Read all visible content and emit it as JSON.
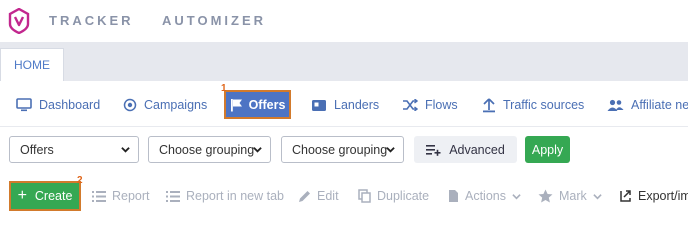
{
  "apps": {
    "tracker": "TRACKER",
    "automizer": "AUTOMIZER"
  },
  "tabs": {
    "home": "HOME"
  },
  "nav": {
    "items": [
      {
        "label": "Dashboard",
        "icon": "monitor-icon"
      },
      {
        "label": "Campaigns",
        "icon": "target-icon"
      },
      {
        "label": "Offers",
        "icon": "flag-icon",
        "active": true,
        "marker": "1"
      },
      {
        "label": "Landers",
        "icon": "lander-icon"
      },
      {
        "label": "Flows",
        "icon": "shuffle-icon"
      },
      {
        "label": "Traffic sources",
        "icon": "arrow-up-icon"
      },
      {
        "label": "Affiliate net",
        "icon": "users-icon"
      }
    ]
  },
  "filters": {
    "entity": "Offers",
    "grouping1": "Choose grouping",
    "grouping2": "Choose grouping",
    "advanced": "Advanced",
    "apply": "Apply"
  },
  "toolbar": {
    "create": "Create",
    "create_marker": "2",
    "report": "Report",
    "report_new_tab": "Report in new tab",
    "edit": "Edit",
    "duplicate": "Duplicate",
    "actions": "Actions",
    "mark": "Mark",
    "export": "Export/im"
  },
  "colors": {
    "brand_pink": "#c2278e",
    "nav_blue": "#4a6fb4",
    "active_bg": "#4d74c4",
    "highlight_orange": "#d27a2c",
    "green": "#35a853"
  }
}
